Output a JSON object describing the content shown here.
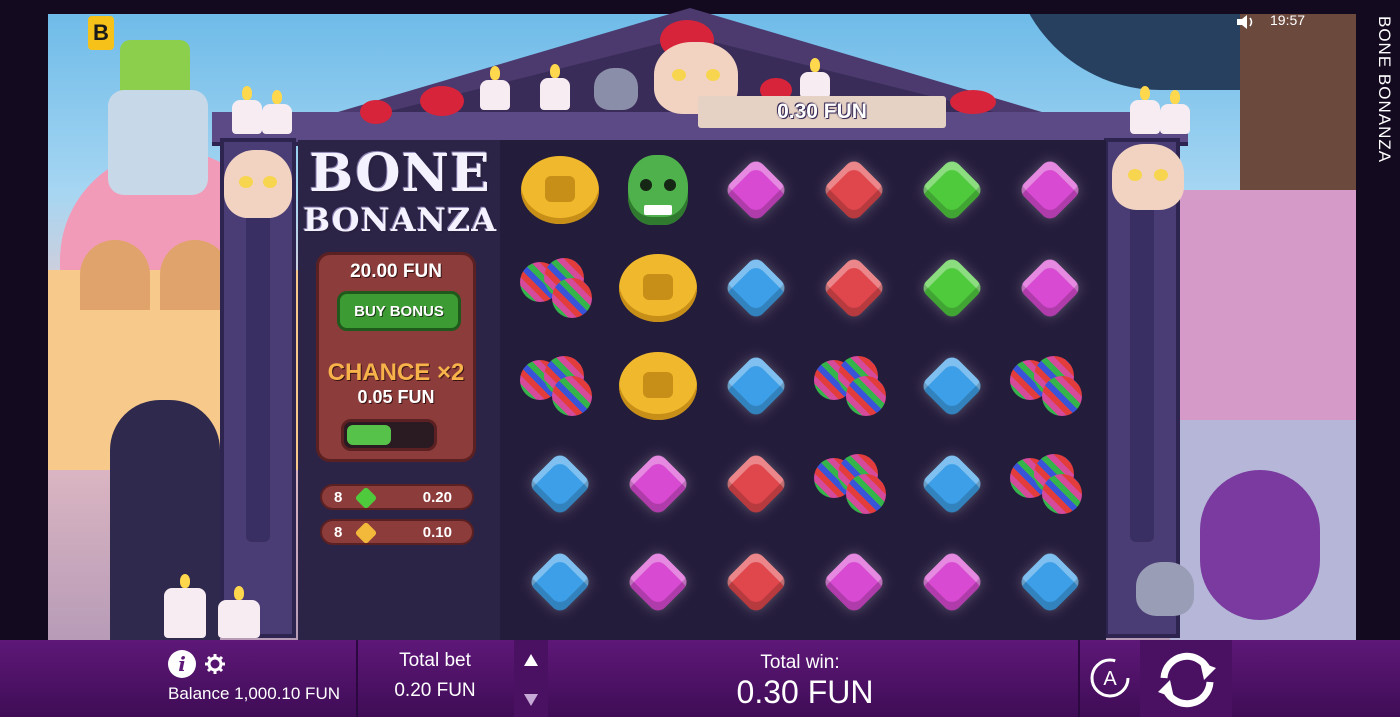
{
  "game": {
    "title_vertical": "BONE BONANZA",
    "logo_line1": "BONE",
    "logo_line2": "BONANZA",
    "brand_letter": "B"
  },
  "status": {
    "time": "19:57"
  },
  "win_banner": "0.30 FUN",
  "bonus": {
    "price": "20.00 FUN",
    "buy_label": "BUY BONUS",
    "chance_label": "CHANCE ×2",
    "chance_price": "0.05 FUN",
    "chance_toggle_on": true
  },
  "paytable": [
    {
      "count": "8",
      "gem": "green",
      "amount": "0.20",
      "color": "#4fca3d"
    },
    {
      "count": "8",
      "gem": "yellow",
      "amount": "0.10",
      "color": "#f2b93b"
    }
  ],
  "grid": [
    [
      "sun",
      "skull",
      "magenta",
      "red",
      "green",
      "magenta"
    ],
    [
      "maracas",
      "sun",
      "blue",
      "red",
      "green",
      "magenta"
    ],
    [
      "maracas",
      "sun",
      "blue",
      "maracas",
      "blue",
      "maracas"
    ],
    [
      "blue",
      "magenta",
      "red",
      "maracas",
      "blue",
      "maracas"
    ],
    [
      "blue",
      "magenta",
      "red",
      "magenta",
      "magenta",
      "blue"
    ]
  ],
  "bottom_bar": {
    "balance": "Balance 1,000.10 FUN",
    "total_bet_label": "Total bet",
    "total_bet_value": "0.20 FUN",
    "total_win_label": "Total win:",
    "total_win_value": "0.30 FUN",
    "info_icon": "info-icon",
    "settings_icon": "gear-icon",
    "autoplay_icon": "autoplay-icon",
    "spin_icon": "spin-icon"
  }
}
